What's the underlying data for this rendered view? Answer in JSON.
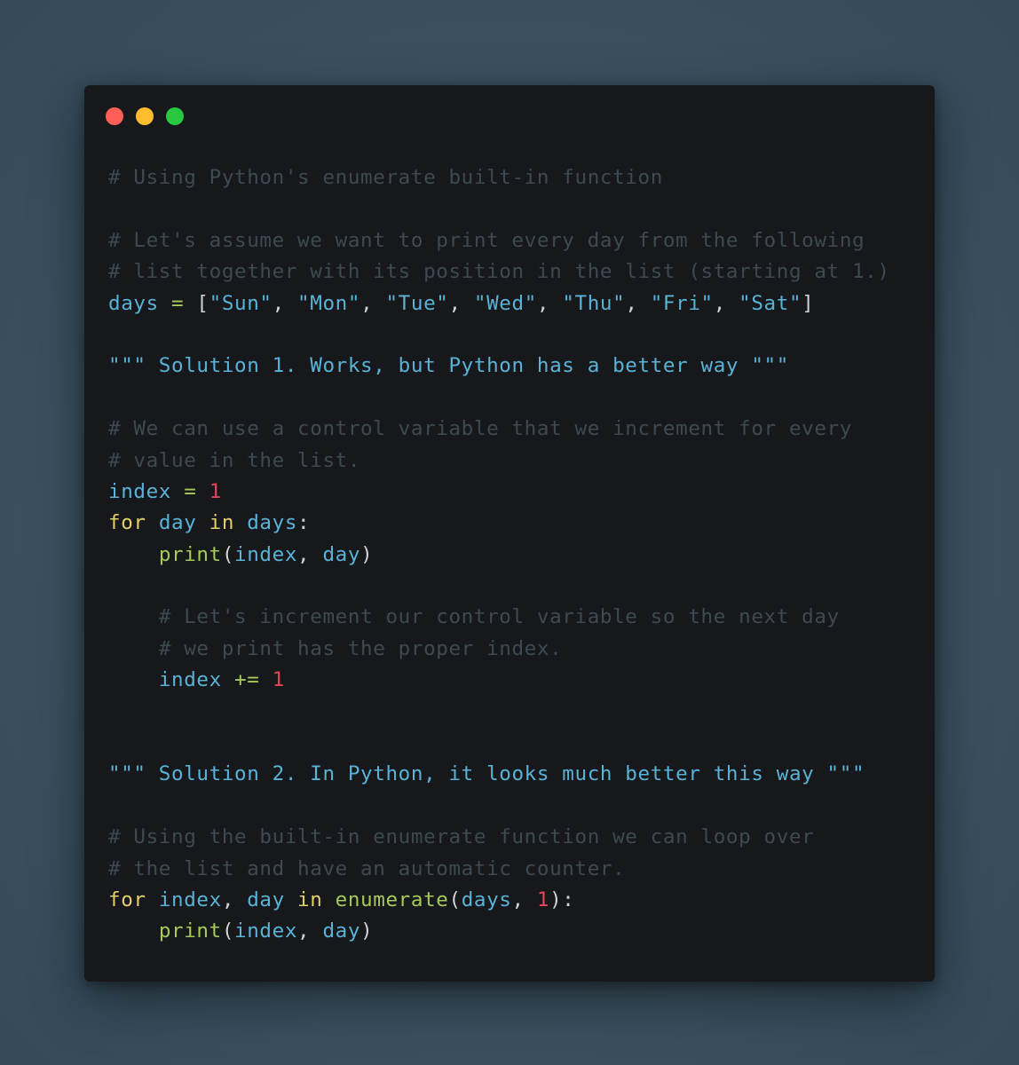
{
  "window": {
    "controls": [
      {
        "name": "close",
        "color": "#ff5f57"
      },
      {
        "name": "minimize",
        "color": "#febc2e"
      },
      {
        "name": "maximize",
        "color": "#28c840"
      }
    ]
  },
  "code": {
    "language": "python",
    "lines": [
      [
        {
          "t": "comment",
          "v": "# Using Python's enumerate built-in function"
        }
      ],
      [],
      [
        {
          "t": "comment",
          "v": "# Let's assume we want to print every day from the following"
        }
      ],
      [
        {
          "t": "comment",
          "v": "# list together with its position in the list (starting at 1.)"
        }
      ],
      [
        {
          "t": "var",
          "v": "days"
        },
        {
          "t": "punc",
          "v": " "
        },
        {
          "t": "op",
          "v": "="
        },
        {
          "t": "punc",
          "v": " ["
        },
        {
          "t": "str",
          "v": "\"Sun\""
        },
        {
          "t": "punc",
          "v": ", "
        },
        {
          "t": "str",
          "v": "\"Mon\""
        },
        {
          "t": "punc",
          "v": ", "
        },
        {
          "t": "str",
          "v": "\"Tue\""
        },
        {
          "t": "punc",
          "v": ", "
        },
        {
          "t": "str",
          "v": "\"Wed\""
        },
        {
          "t": "punc",
          "v": ", "
        },
        {
          "t": "str",
          "v": "\"Thu\""
        },
        {
          "t": "punc",
          "v": ", "
        },
        {
          "t": "str",
          "v": "\"Fri\""
        },
        {
          "t": "punc",
          "v": ", "
        },
        {
          "t": "str",
          "v": "\"Sat\""
        },
        {
          "t": "punc",
          "v": "]"
        }
      ],
      [],
      [
        {
          "t": "doc",
          "v": "\"\"\" Solution 1. Works, but Python has a better way \"\"\""
        }
      ],
      [],
      [
        {
          "t": "comment",
          "v": "# We can use a control variable that we increment for every"
        }
      ],
      [
        {
          "t": "comment",
          "v": "# value in the list."
        }
      ],
      [
        {
          "t": "var",
          "v": "index"
        },
        {
          "t": "punc",
          "v": " "
        },
        {
          "t": "op",
          "v": "="
        },
        {
          "t": "punc",
          "v": " "
        },
        {
          "t": "num",
          "v": "1"
        }
      ],
      [
        {
          "t": "kw",
          "v": "for"
        },
        {
          "t": "punc",
          "v": " "
        },
        {
          "t": "var",
          "v": "day"
        },
        {
          "t": "punc",
          "v": " "
        },
        {
          "t": "kw",
          "v": "in"
        },
        {
          "t": "punc",
          "v": " "
        },
        {
          "t": "var",
          "v": "days"
        },
        {
          "t": "punc",
          "v": ":"
        }
      ],
      [
        {
          "t": "punc",
          "v": "    "
        },
        {
          "t": "fn",
          "v": "print"
        },
        {
          "t": "punc",
          "v": "("
        },
        {
          "t": "var",
          "v": "index"
        },
        {
          "t": "punc",
          "v": ", "
        },
        {
          "t": "var",
          "v": "day"
        },
        {
          "t": "punc",
          "v": ")"
        }
      ],
      [],
      [
        {
          "t": "punc",
          "v": "    "
        },
        {
          "t": "comment",
          "v": "# Let's increment our control variable so the next day"
        }
      ],
      [
        {
          "t": "punc",
          "v": "    "
        },
        {
          "t": "comment",
          "v": "# we print has the proper index."
        }
      ],
      [
        {
          "t": "punc",
          "v": "    "
        },
        {
          "t": "var",
          "v": "index"
        },
        {
          "t": "punc",
          "v": " "
        },
        {
          "t": "op",
          "v": "+="
        },
        {
          "t": "punc",
          "v": " "
        },
        {
          "t": "num",
          "v": "1"
        }
      ],
      [],
      [],
      [
        {
          "t": "doc",
          "v": "\"\"\" Solution 2. In Python, it looks much better this way \"\"\""
        }
      ],
      [],
      [
        {
          "t": "comment",
          "v": "# Using the built-in enumerate function we can loop over"
        }
      ],
      [
        {
          "t": "comment",
          "v": "# the list and have an automatic counter."
        }
      ],
      [
        {
          "t": "kw",
          "v": "for"
        },
        {
          "t": "punc",
          "v": " "
        },
        {
          "t": "var",
          "v": "index"
        },
        {
          "t": "punc",
          "v": ", "
        },
        {
          "t": "var",
          "v": "day"
        },
        {
          "t": "punc",
          "v": " "
        },
        {
          "t": "kw",
          "v": "in"
        },
        {
          "t": "punc",
          "v": " "
        },
        {
          "t": "fn",
          "v": "enumerate"
        },
        {
          "t": "punc",
          "v": "("
        },
        {
          "t": "var",
          "v": "days"
        },
        {
          "t": "punc",
          "v": ", "
        },
        {
          "t": "num",
          "v": "1"
        },
        {
          "t": "punc",
          "v": "):"
        }
      ],
      [
        {
          "t": "punc",
          "v": "    "
        },
        {
          "t": "fn",
          "v": "print"
        },
        {
          "t": "punc",
          "v": "("
        },
        {
          "t": "var",
          "v": "index"
        },
        {
          "t": "punc",
          "v": ", "
        },
        {
          "t": "var",
          "v": "day"
        },
        {
          "t": "punc",
          "v": ")"
        }
      ]
    ]
  }
}
